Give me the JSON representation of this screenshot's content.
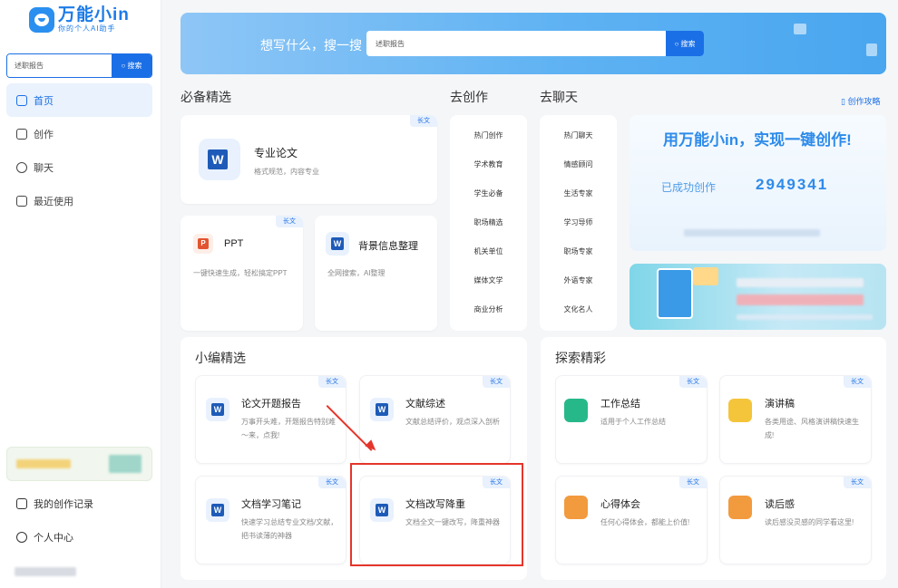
{
  "brand": {
    "title": "万能小in",
    "subtitle": "你的个人AI助手"
  },
  "sidebar": {
    "search": {
      "value": "述职报告",
      "button": "搜索"
    },
    "nav": [
      {
        "label": "首页",
        "icon": "home-icon",
        "active": true
      },
      {
        "label": "创作",
        "icon": "edit-icon",
        "active": false
      },
      {
        "label": "聊天",
        "icon": "chat-icon",
        "active": false
      },
      {
        "label": "最近使用",
        "icon": "history-icon",
        "active": false
      }
    ],
    "bottom": [
      {
        "label": "我的创作记录",
        "icon": "document-icon"
      },
      {
        "label": "个人中心",
        "icon": "user-icon"
      }
    ]
  },
  "hero": {
    "prompt": "想写什么，搜一搜",
    "search_value": "述职报告",
    "button": "搜索"
  },
  "sections": {
    "must": "必备精选",
    "create": "去创作",
    "chat": "去聊天",
    "guide": "创作攻略",
    "editor": "小编精选",
    "explore": "探索精彩"
  },
  "tag": "长文",
  "must_cards": {
    "main": {
      "title": "专业论文",
      "desc": "格式规范，内容专业"
    },
    "ppt": {
      "title": "PPT",
      "desc": "一键快速生成，轻松搞定PPT"
    },
    "bg": {
      "title": "背景信息整理",
      "desc": "全网搜索，AI整理"
    }
  },
  "create_list": [
    "热门创作",
    "学术教育",
    "学生必备",
    "职场精选",
    "机关单位",
    "媒体文学",
    "商业分析"
  ],
  "chat_list": [
    "热门聊天",
    "情感顾问",
    "生活专家",
    "学习导师",
    "职场专家",
    "外语专家",
    "文化名人"
  ],
  "stats": {
    "title": "用万能小in，实现一键创作!",
    "label": "已成功创作",
    "count": "2949341"
  },
  "editor_cards": [
    {
      "title": "论文开题报告",
      "desc": "万事开头难，开题报告特别难～来，点我!"
    },
    {
      "title": "文献综述",
      "desc": "文献总结评价，观点深入剖析"
    },
    {
      "title": "文档学习笔记",
      "desc": "快速学习总结专业文档/文献，把书读薄的神器"
    },
    {
      "title": "文档改写降重",
      "desc": "文档全文一键改写，降重神器"
    }
  ],
  "explore_cards": [
    {
      "title": "工作总结",
      "desc": "适用于个人工作总结",
      "icon": "checklist-icon",
      "color": "#27b88a"
    },
    {
      "title": "演讲稿",
      "desc": "各类用途、风格演讲稿快速生成!",
      "icon": "microphone-icon",
      "color": "#f4c53b"
    },
    {
      "title": "心得体会",
      "desc": "任何心得体会，都能上价值!",
      "icon": "notebook-icon",
      "color": "#f29a3e"
    },
    {
      "title": "读后感",
      "desc": "读后感没灵感的同学看这里!",
      "icon": "notebook-icon",
      "color": "#f29a3e"
    }
  ],
  "colors": {
    "accent": "#1b6fe6",
    "highlight": "#e5352b"
  }
}
